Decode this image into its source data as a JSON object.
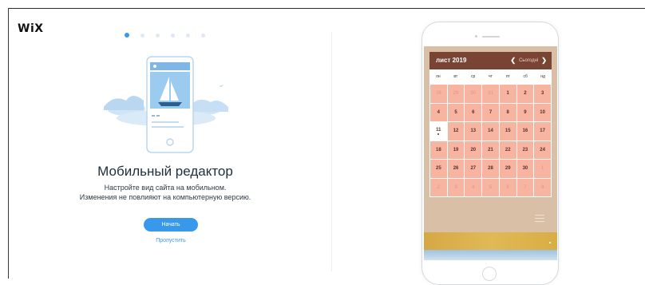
{
  "brand": {
    "logo": "WiX"
  },
  "onboarding": {
    "steps_total": 6,
    "current_step": 1,
    "title": "Мобильный редактор",
    "subtitle_line1": "Настройте вид сайта на мобильном.",
    "subtitle_line2": "Изменения не повлияют на компьютерную версию.",
    "start_button": "Начать",
    "skip_link": "Пропустить"
  },
  "preview": {
    "calendar": {
      "month": "лист 2019",
      "today_label": "Сьогодні",
      "prev_icon": "chevron-left-icon",
      "next_icon": "chevron-right-icon",
      "weekdays": [
        "пн",
        "вт",
        "ср",
        "чт",
        "пт",
        "сб",
        "нд"
      ],
      "weeks": [
        [
          "28",
          "29",
          "30",
          "31",
          "1",
          "2",
          "3"
        ],
        [
          "4",
          "5",
          "6",
          "7",
          "8",
          "9",
          "10"
        ],
        [
          "11",
          "12",
          "13",
          "14",
          "15",
          "16",
          "17"
        ],
        [
          "18",
          "19",
          "20",
          "21",
          "22",
          "23",
          "24"
        ],
        [
          "25",
          "26",
          "27",
          "28",
          "29",
          "30",
          "1"
        ],
        [
          "2",
          "3",
          "4",
          "5",
          "6",
          "7",
          "8"
        ]
      ],
      "muted_cells": [
        [
          0,
          0
        ],
        [
          0,
          1
        ],
        [
          0,
          2
        ],
        [
          0,
          3
        ],
        [
          4,
          6
        ],
        [
          5,
          0
        ],
        [
          5,
          1
        ],
        [
          5,
          2
        ],
        [
          5,
          3
        ],
        [
          5,
          4
        ],
        [
          5,
          5
        ],
        [
          5,
          6
        ]
      ],
      "today_cell": [
        2,
        0
      ]
    },
    "colors": {
      "header": "#7a4435",
      "cell": "#f7b4a0",
      "accent": "#3899ec"
    }
  }
}
